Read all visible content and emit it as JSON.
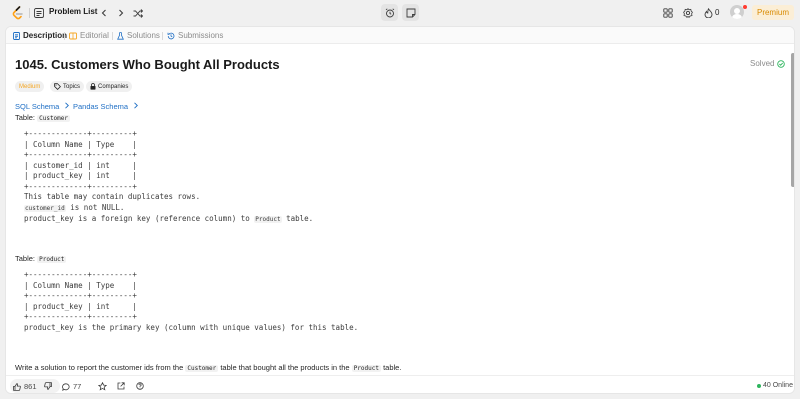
{
  "nav": {
    "problem_list_label": "Problem List",
    "coins": "0",
    "premium_label": "Premium"
  },
  "tabs": [
    {
      "label": "Description",
      "icon": "description-icon",
      "active": true
    },
    {
      "label": "Editorial",
      "icon": "editorial-icon",
      "active": false
    },
    {
      "label": "Solutions",
      "icon": "solutions-flask-icon",
      "active": false
    },
    {
      "label": "Submissions",
      "icon": "history-icon",
      "active": false
    }
  ],
  "problem": {
    "title": "1045. Customers Who Bought All Products",
    "status": "Solved",
    "difficulty": "Medium",
    "topics_label": "Topics",
    "companies_label": "Companies",
    "sql_schema_label": "SQL Schema",
    "pandas_schema_label": "Pandas Schema",
    "table_prefix": "Table:",
    "table1_name": "Customer",
    "table1_lines": [
      "+-------------+---------+",
      "| Column Name | Type    |",
      "+-------------+---------+",
      "| customer_id | int     |",
      "| product_key | int     |",
      "+-------------+---------+"
    ],
    "table1_note1": "This table may contain duplicates rows.",
    "table1_note2_code": "customer_id",
    "table1_note2_rest": " is not NULL.",
    "table1_note3_pre": "product_key is a foreign key (reference column) to ",
    "table1_note3_code": "Product",
    "table1_note3_post": " table.",
    "table2_name": "Product",
    "table2_lines": [
      "+-------------+---------+",
      "| Column Name | Type    |",
      "+-------------+---------+",
      "| product_key | int     |",
      "+-------------+---------+"
    ],
    "table2_note": "product_key is the primary key (column with unique values) for this table.",
    "prompt_pre": "Write a solution to report the customer ids from the ",
    "prompt_code1": "Customer",
    "prompt_mid": " table that bought all the products in the ",
    "prompt_code2": "Product",
    "prompt_post": " table."
  },
  "footer": {
    "likes": "861",
    "comments": "77",
    "online": "40 Online"
  }
}
